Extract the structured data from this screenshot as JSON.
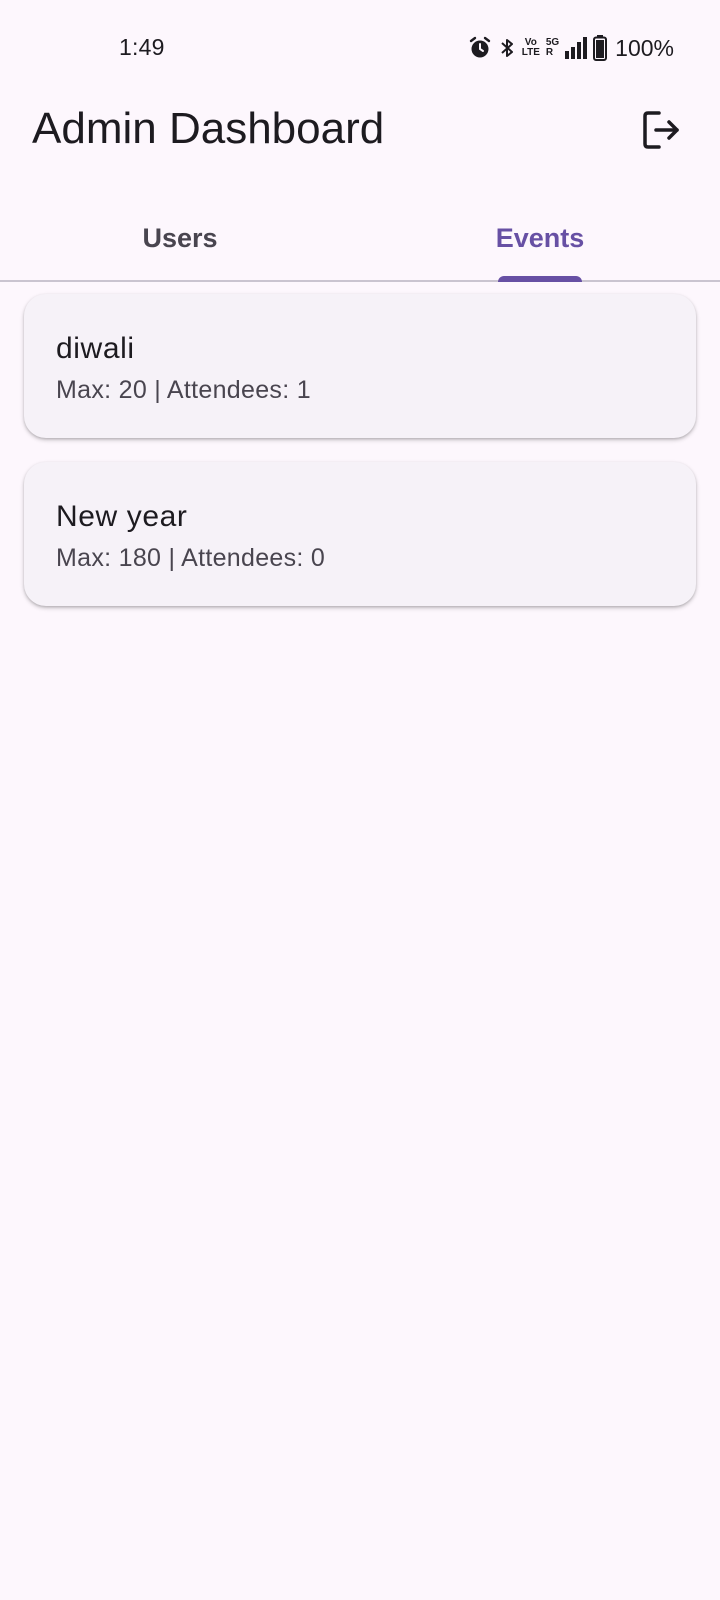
{
  "status_bar": {
    "time": "1:49",
    "network_top": "Vo",
    "network_bottom": "LTE",
    "signal_top": "5G",
    "signal_bottom": "R",
    "battery_percent": "100%"
  },
  "app_bar": {
    "title": "Admin Dashboard",
    "logout_icon": "logout-icon"
  },
  "tabs": [
    {
      "label": "Users",
      "selected": false
    },
    {
      "label": "Events",
      "selected": true
    }
  ],
  "events": [
    {
      "name": "diwali",
      "meta": "Max: 20 | Attendees: 1"
    },
    {
      "name": "New year",
      "meta": "Max: 180 | Attendees: 0"
    }
  ],
  "colors": {
    "background": "#fdf7fd",
    "accent": "#6750a4",
    "card": "#f6f2f8",
    "text_primary": "#1d1b20",
    "text_secondary": "#49454f",
    "divider": "#cac4d0"
  }
}
